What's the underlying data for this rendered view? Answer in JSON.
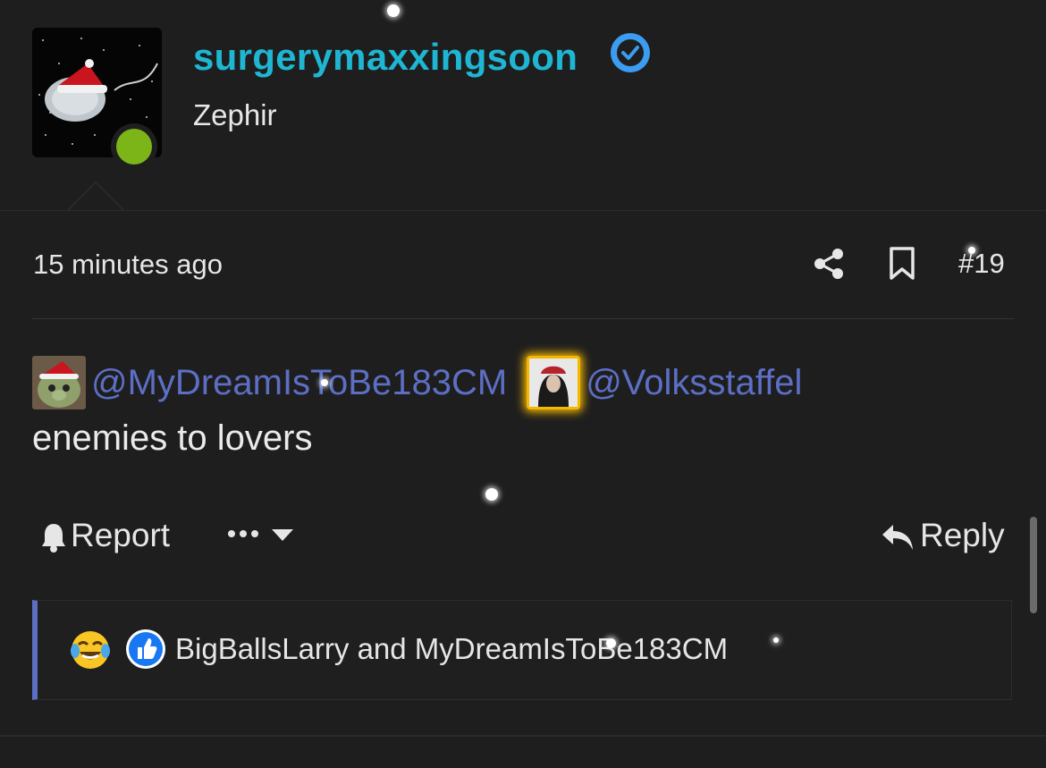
{
  "author": {
    "username": "surgerymaxxingsoon",
    "title": "Zephir",
    "online": true,
    "verified": true
  },
  "post": {
    "timestamp": "15 minutes ago",
    "number": "#19",
    "mentions": [
      "@MyDreamIsToBe183CM",
      "@Volksstaffel"
    ],
    "body": "enemies to lovers"
  },
  "actions": {
    "report": "Report",
    "more": "•••",
    "reply": "Reply"
  },
  "reactions": {
    "icons": [
      "joy-emoji",
      "like-icon"
    ],
    "summary": "BigBallsLarry and MyDreamIsToBe183CM"
  },
  "colors": {
    "background": "#1e1e1e",
    "username": "#1fb6d3",
    "mention": "#5c6fc4",
    "online": "#7cb518",
    "verified": "#3b9cf2",
    "highlight": "#f5b800"
  }
}
